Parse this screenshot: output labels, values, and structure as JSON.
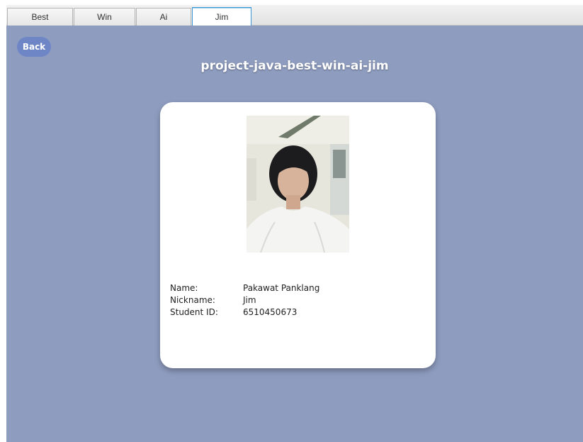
{
  "tabs": [
    {
      "label": "Best",
      "selected": false
    },
    {
      "label": "Win",
      "selected": false
    },
    {
      "label": "Ai",
      "selected": false
    },
    {
      "label": "Jim",
      "selected": true
    }
  ],
  "back_button": {
    "label": "Back"
  },
  "page_title": "project-java-best-win-ai-jim",
  "profile": {
    "photo": "profile-photo",
    "fields": [
      {
        "label": "Name:",
        "value": "Pakawat Panklang"
      },
      {
        "label": "Nickname:",
        "value": "Jim"
      },
      {
        "label": "Student ID:",
        "value": "6510450673"
      }
    ]
  },
  "colors": {
    "background": "#8e9cbf",
    "back_button": "#6f86c6",
    "card": "#ffffff",
    "selected_tab_border": "#3a96d6"
  }
}
